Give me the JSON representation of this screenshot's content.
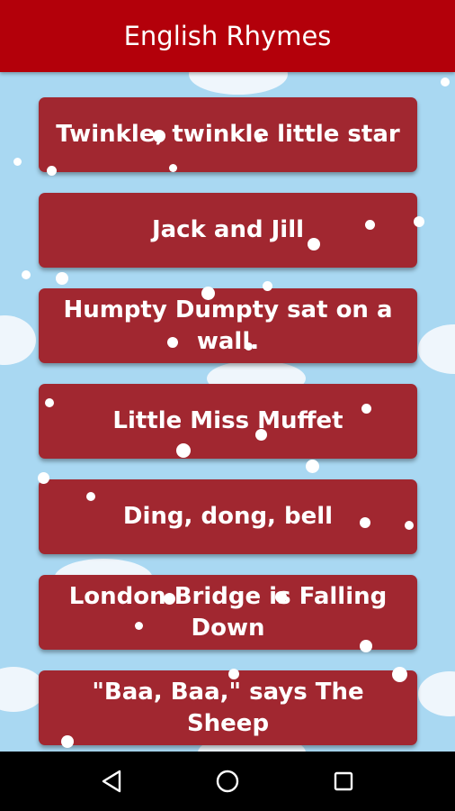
{
  "app": {
    "title": "English Rhymes"
  },
  "rhymes": [
    {
      "label": "Twinkle, twinkle little star"
    },
    {
      "label": "Jack and Jill"
    },
    {
      "label": "Humpty Dumpty sat on a wall."
    },
    {
      "label": "Little Miss Muffet"
    },
    {
      "label": "Ding, dong, bell"
    },
    {
      "label": "London Bridge is Falling Down"
    },
    {
      "label": "\"Baa, Baa,\" says The Sheep"
    }
  ],
  "navigation": {
    "back_icon": "back-triangle-icon",
    "home_icon": "home-circle-icon",
    "recents_icon": "recents-square-icon"
  },
  "colors": {
    "appbar": "#b3000a",
    "card": "#a12730",
    "background": "#a9d8f2"
  }
}
